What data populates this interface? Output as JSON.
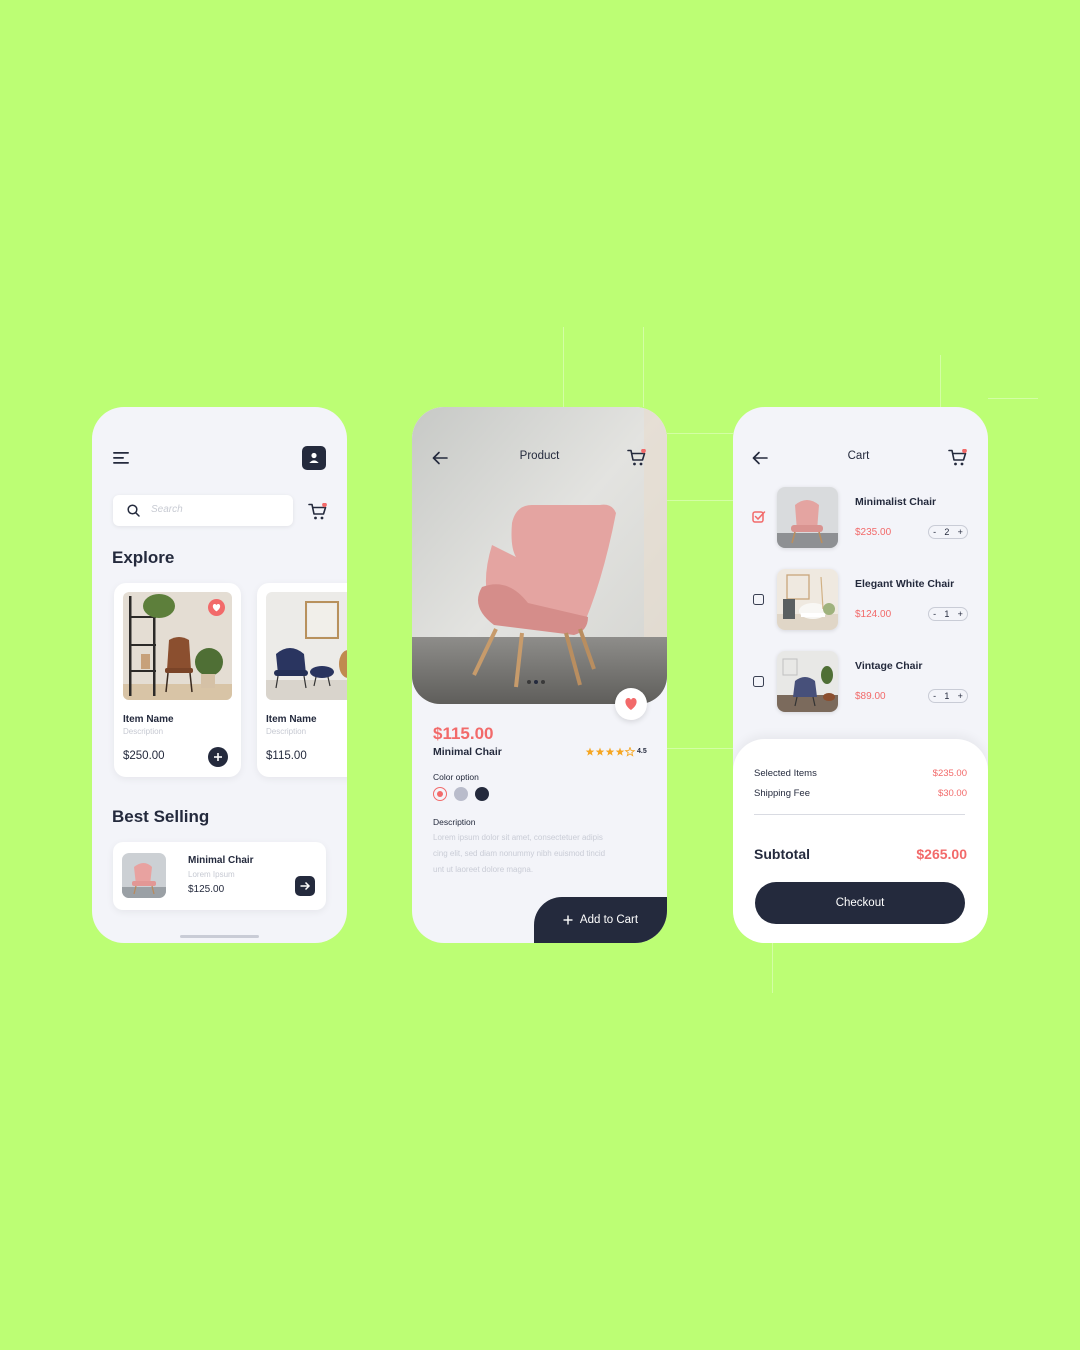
{
  "colors": {
    "background": "#bcfe74",
    "navy": "#242a3d",
    "coral": "#f26a6a",
    "panel": "#f3f4f9"
  },
  "explore_screen": {
    "search_placeholder": "Search",
    "explore_title": "Explore",
    "items": [
      {
        "name": "Item Name",
        "description": "Description",
        "price": "$250.00"
      },
      {
        "name": "Item Name",
        "description": "Description",
        "price": "$115.00"
      }
    ],
    "best_selling_title": "Best Selling",
    "best_selling": {
      "name": "Minimal Chair",
      "description": "Lorem Ipsum",
      "price": "$125.00"
    }
  },
  "product_screen": {
    "title": "Product",
    "price": "$115.00",
    "name": "Minimal Chair",
    "rating": "4.5",
    "color_option_label": "Color option",
    "color_options": [
      "#f26a6a",
      "#b9bccb",
      "#242a3d"
    ],
    "description_label": "Description",
    "description_lines": [
      "Lorem ipsum dolor sit amet, consectetuer adipis",
      "cing elit, sed diam nonummy nibh euismod tincid",
      "unt ut laoreet dolore magna."
    ],
    "add_to_cart": "Add to Cart"
  },
  "cart_screen": {
    "title": "Cart",
    "items": [
      {
        "name": "Minimalist Chair",
        "price": "$235.00",
        "qty": "2",
        "checked": true
      },
      {
        "name": "Elegant White Chair",
        "price": "$124.00",
        "qty": "1",
        "checked": false
      },
      {
        "name": "Vintage Chair",
        "price": "$89.00",
        "qty": "1",
        "checked": false
      }
    ],
    "selected_items_label": "Selected Items",
    "selected_items_value": "$235.00",
    "shipping_fee_label": "Shipping Fee",
    "shipping_fee_value": "$30.00",
    "subtotal_label": "Subtotal",
    "subtotal_value": "$265.00",
    "checkout": "Checkout"
  },
  "icons": [
    "menu-icon",
    "user-icon",
    "search-icon",
    "cart-icon",
    "heart-icon",
    "plus-icon",
    "arrow-right-icon",
    "back-arrow-icon",
    "star-icon",
    "checkbox-icon"
  ]
}
